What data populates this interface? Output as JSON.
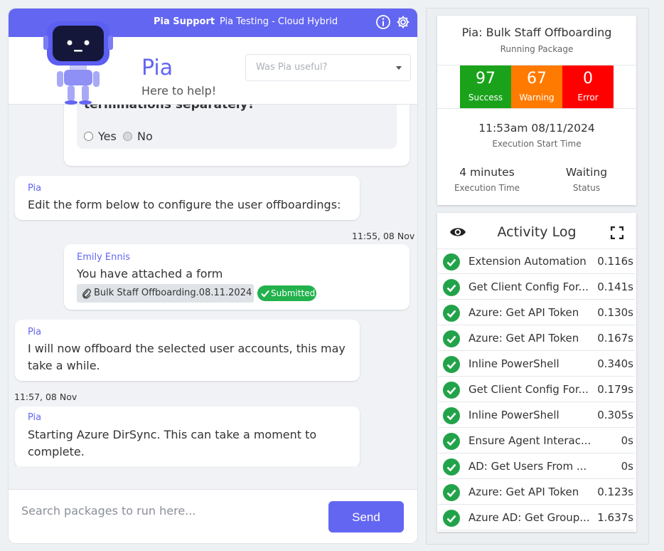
{
  "topbar": {
    "app_name": "Pia Support",
    "tenant": "Pia Testing - Cloud Hybrid"
  },
  "header": {
    "title": "Pia",
    "subtitle": "Here to help!",
    "feedback_placeholder": "Was Pia useful?"
  },
  "chat": {
    "cut_question": "terminations separately?",
    "radio_yes": "Yes",
    "radio_no": "No",
    "messages": [
      {
        "sender": "Pia",
        "text": "Edit the form below to configure the user offboardings:"
      },
      {
        "timestamp": "11:55, 08 Nov",
        "sender": "Emily Ennis",
        "text": "You have attached a form",
        "attachment": "Bulk Staff Offboarding.08.11.2024",
        "status": "Submitted"
      },
      {
        "sender": "Pia",
        "text_line1": "I will now offboard the selected user accounts, this may",
        "text_line2": "take a while."
      },
      {
        "timestamp": "11:57, 08 Nov",
        "sender": "Pia",
        "text_line1": "Starting Azure DirSync. This can take a moment to",
        "text_line2": "complete."
      }
    ],
    "input_placeholder": "Search packages to run here...",
    "send_label": "Send"
  },
  "package": {
    "title": "Pia: Bulk Staff Offboarding",
    "subtitle": "Running Package",
    "stats": [
      {
        "value": "97",
        "label": "Success",
        "color": "#1aa31a"
      },
      {
        "value": "67",
        "label": "Warning",
        "color": "#ff7a00"
      },
      {
        "value": "0",
        "label": "Error",
        "color": "#ff0000"
      }
    ],
    "start_time": "11:53am 08/11/2024",
    "start_time_label": "Execution Start Time",
    "exec_time": "4 minutes",
    "exec_time_label": "Execution Time",
    "status": "Waiting",
    "status_label": "Status"
  },
  "activity_log": {
    "title": "Activity Log",
    "items": [
      {
        "name": "Extension Automation",
        "time": "0.116s"
      },
      {
        "name": "Get Client Config For...",
        "time": "0.141s"
      },
      {
        "name": "Azure: Get API Token",
        "time": "0.130s"
      },
      {
        "name": "Azure: Get API Token",
        "time": "0.167s"
      },
      {
        "name": "Inline PowerShell",
        "time": "0.340s"
      },
      {
        "name": "Get Client Config For...",
        "time": "0.179s"
      },
      {
        "name": "Inline PowerShell",
        "time": "0.305s"
      },
      {
        "name": "Ensure Agent Interac...",
        "time": "0s"
      },
      {
        "name": "AD: Get Users From ...",
        "time": "0s"
      },
      {
        "name": "Azure: Get API Token",
        "time": "0.123s"
      },
      {
        "name": "Azure AD: Get Group...",
        "time": "1.637s"
      }
    ]
  },
  "colors": {
    "accent": "#6366f1",
    "success": "#1aa31a"
  }
}
